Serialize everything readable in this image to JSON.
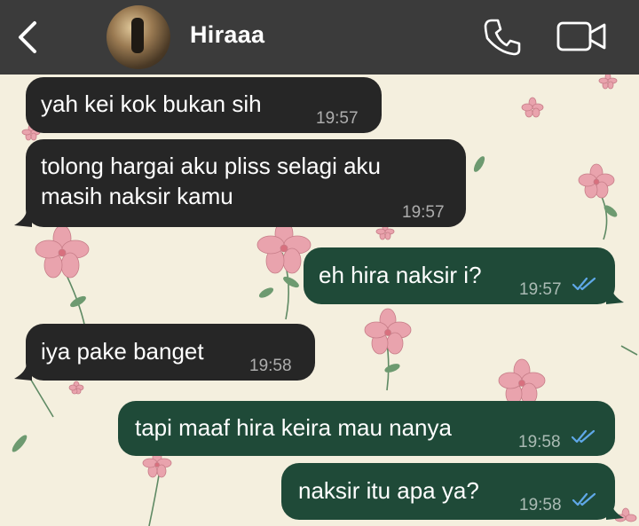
{
  "header": {
    "contact_name": "Hiraaa"
  },
  "messages": [
    {
      "direction": "incoming",
      "text": "yah kei kok bukan sih",
      "time": "19:57"
    },
    {
      "direction": "incoming",
      "text": "tolong hargai aku pliss selagi aku\nmasih naksir kamu",
      "time": "19:57"
    },
    {
      "direction": "outgoing",
      "text": "eh hira naksir i?",
      "time": "19:57",
      "status": "read"
    },
    {
      "direction": "incoming",
      "text": "iya pake banget",
      "time": "19:58"
    },
    {
      "direction": "outgoing",
      "text": "tapi maaf hira keira mau nanya",
      "time": "19:58",
      "status": "read"
    },
    {
      "direction": "outgoing",
      "text": "naksir itu apa ya?",
      "time": "19:58",
      "status": "read"
    }
  ],
  "colors": {
    "header_bg": "#3b3b3b",
    "incoming_bubble": "#262626",
    "outgoing_bubble": "#1f4a38",
    "read_ticks": "#5fa8e8",
    "wallpaper": "#f4efde"
  },
  "icons": [
    "back-chevron-icon",
    "phone-icon",
    "video-camera-icon",
    "read-receipt-icon"
  ]
}
